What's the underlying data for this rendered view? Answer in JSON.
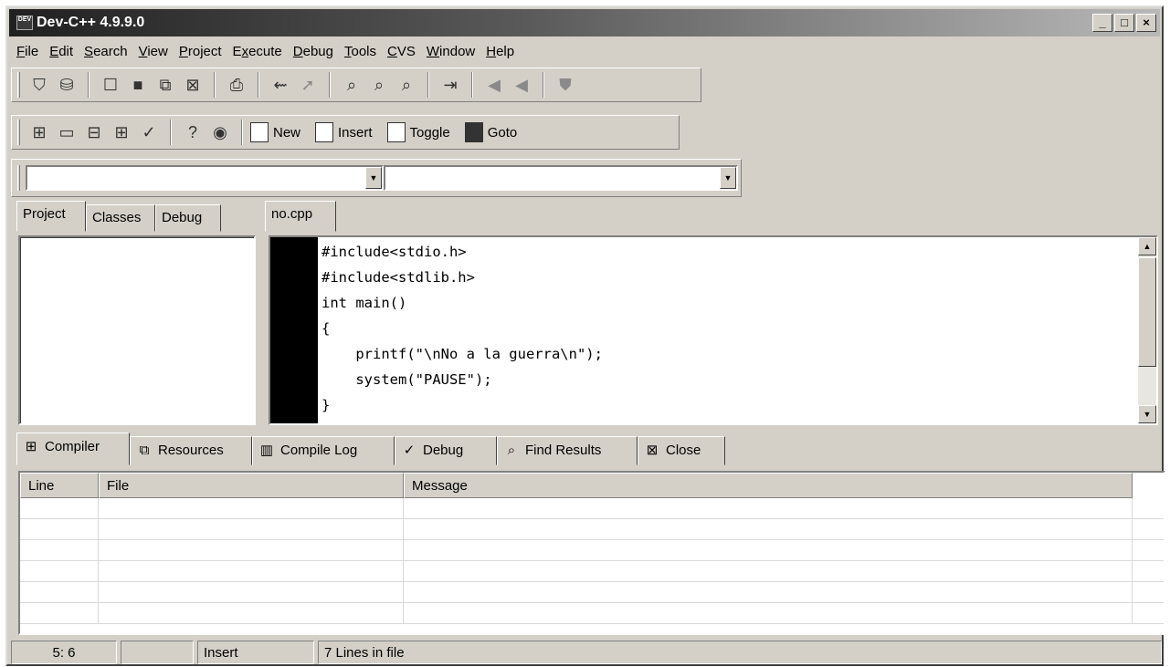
{
  "window": {
    "title": "Dev-C++ 4.9.9.0",
    "icon_text": "DEV"
  },
  "window_buttons": {
    "minimize": "_",
    "maximize": "□",
    "close": "×"
  },
  "menu": [
    {
      "label": "File",
      "key": "F",
      "rest": "ile"
    },
    {
      "label": "Edit",
      "key": "E",
      "rest": "dit"
    },
    {
      "label": "Search",
      "key": "S",
      "rest": "earch"
    },
    {
      "label": "View",
      "key": "V",
      "rest": "iew"
    },
    {
      "label": "Project",
      "key": "P",
      "rest": "roject"
    },
    {
      "label": "Execute",
      "key": "x",
      "pre": "E",
      "rest": "ecute"
    },
    {
      "label": "Debug",
      "key": "D",
      "rest": "ebug"
    },
    {
      "label": "Tools",
      "key": "T",
      "rest": "ools"
    },
    {
      "label": "CVS",
      "key": "C",
      "rest": "VS"
    },
    {
      "label": "Window",
      "key": "W",
      "rest": "indow"
    },
    {
      "label": "Help",
      "key": "H",
      "rest": "elp"
    }
  ],
  "toolbar2": {
    "new_label": "New",
    "insert_label": "Insert",
    "toggle_label": "Toggle",
    "goto_label": "Goto"
  },
  "left_tabs": [
    "Project",
    "Classes",
    "Debug"
  ],
  "editor": {
    "tab": "no.cpp",
    "lines": [
      "#include<stdio.h>",
      "#include<stdlib.h>",
      "int main()",
      "{",
      "    printf(\"\\nNo a la guerra\\n\");",
      "    system(\"PAUSE\");",
      "}"
    ]
  },
  "bottom_tabs": [
    "Compiler",
    "Resources",
    "Compile Log",
    "Debug",
    "Find Results",
    "Close"
  ],
  "results": {
    "columns": [
      "Line",
      "File",
      "Message"
    ],
    "rows": 6
  },
  "status": {
    "position": "5: 6",
    "modified": "",
    "mode": "Insert",
    "lines": "7 Lines in file"
  },
  "icons": {
    "scroll_up": "up-arrow-icon",
    "scroll_down": "down-arrow-icon",
    "combo_arrow": "chevron-down-icon"
  }
}
